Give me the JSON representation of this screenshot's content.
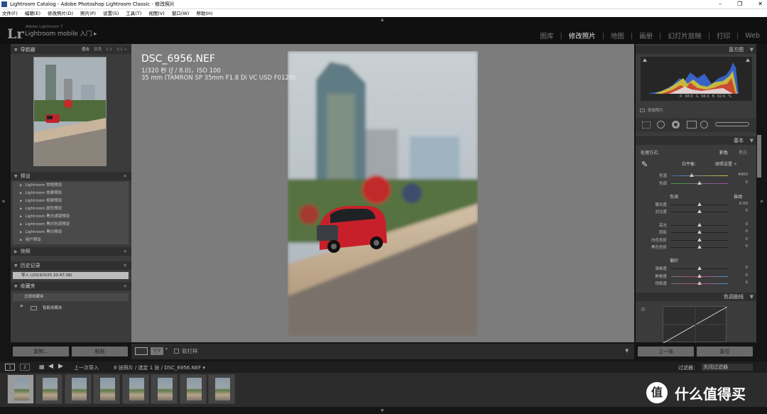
{
  "titlebar": {
    "title": "Lightroom Catalog - Adobe Photoshop Lightroom Classic - 修改照片",
    "min": "–",
    "max": "❐",
    "close": "✕"
  },
  "menu": [
    "文件(F)",
    "编辑(E)",
    "修改照片(D)",
    "照片(P)",
    "设置(S)",
    "工具(T)",
    "视图(V)",
    "窗口(W)",
    "帮助(H)"
  ],
  "identity": {
    "logo": "Lr",
    "small": "Adobe Lightroom 7",
    "main": "Lightroom mobile 入门 ▸"
  },
  "modules": [
    "图库",
    "修改照片",
    "地图",
    "画册",
    "幻灯片放映",
    "打印",
    "Web"
  ],
  "left": {
    "navigator": {
      "title": "导航器",
      "opts": [
        "适合",
        "填满",
        "1:1",
        "3:1 ÷"
      ]
    },
    "presets": {
      "title": "预设",
      "items": [
        "Lightroom 常规预设",
        "Lightroom 效果预设",
        "Lightroom 视频预设",
        "Lightroom 颜色预设",
        "Lightroom 黑白滤镜预设",
        "Lightroom 黑白色调预设",
        "Lightroom 黑白预设",
        "用户预设"
      ]
    },
    "snapshots": {
      "title": "快照"
    },
    "history": {
      "title": "历史记录",
      "item": "导入 (2019/3/25 20:47:38)"
    },
    "collections": {
      "title": "收藏夹",
      "items": [
        "过滤收藏夹",
        "智能收藏夹"
      ]
    },
    "copy_btn": "复制...",
    "paste_btn": "粘贴"
  },
  "center": {
    "filename": "DSC_6956.NEF",
    "exposure": "1/320 秒 (ƒ / 8.0)，ISO 100",
    "lens": "35 mm (TAMRON SP 35mm F1.8 Di VC USD F012N)"
  },
  "toolbar": {
    "softproof": "软打样"
  },
  "right": {
    "histogram": {
      "title": "直方图",
      "r": "68.6",
      "g": "66.6",
      "b": "62.6",
      "pct": "%",
      "original": "原始照片"
    },
    "basic": {
      "title": "基本",
      "treatment": "处理方式:",
      "color": "彩色",
      "bw": "黑白",
      "wb": "白平衡:",
      "wb_val": "原照设置 ÷",
      "temp": {
        "label": "色温",
        "val": "4900",
        "pos": 0.36
      },
      "tint": {
        "label": "色调",
        "val": "0",
        "pos": 0.5
      },
      "tone": "色调",
      "auto": "自动",
      "sliders1": [
        {
          "label": "曝光度",
          "val": "0.00",
          "pos": 0.5
        },
        {
          "label": "对比度",
          "val": "0",
          "pos": 0.5
        }
      ],
      "sliders2": [
        {
          "label": "高光",
          "val": "0",
          "pos": 0.5
        },
        {
          "label": "阴影",
          "val": "0",
          "pos": 0.5
        },
        {
          "label": "白色色阶",
          "val": "0",
          "pos": 0.5
        },
        {
          "label": "黑色色阶",
          "val": "0",
          "pos": 0.5
        }
      ],
      "presence": "偏好",
      "sliders3": [
        {
          "label": "清晰度",
          "val": "0",
          "pos": 0.5
        },
        {
          "label": "鲜艳度",
          "val": "0",
          "pos": 0.5
        },
        {
          "label": "饱和度",
          "val": "0",
          "pos": 0.5
        }
      ]
    },
    "tonecurve": {
      "title": "色调曲线"
    },
    "prev_btn": "上一张",
    "reset_btn": "复位"
  },
  "filmbar": {
    "prev_import": "上一次导入",
    "count": "8 张照片 / 选定 1 张 / DSC_6956.NEF ▾",
    "filter_label": "过滤器：",
    "filter_val": "关闭过滤器"
  },
  "watermark": "什么值得买",
  "watermark_logo": "值"
}
